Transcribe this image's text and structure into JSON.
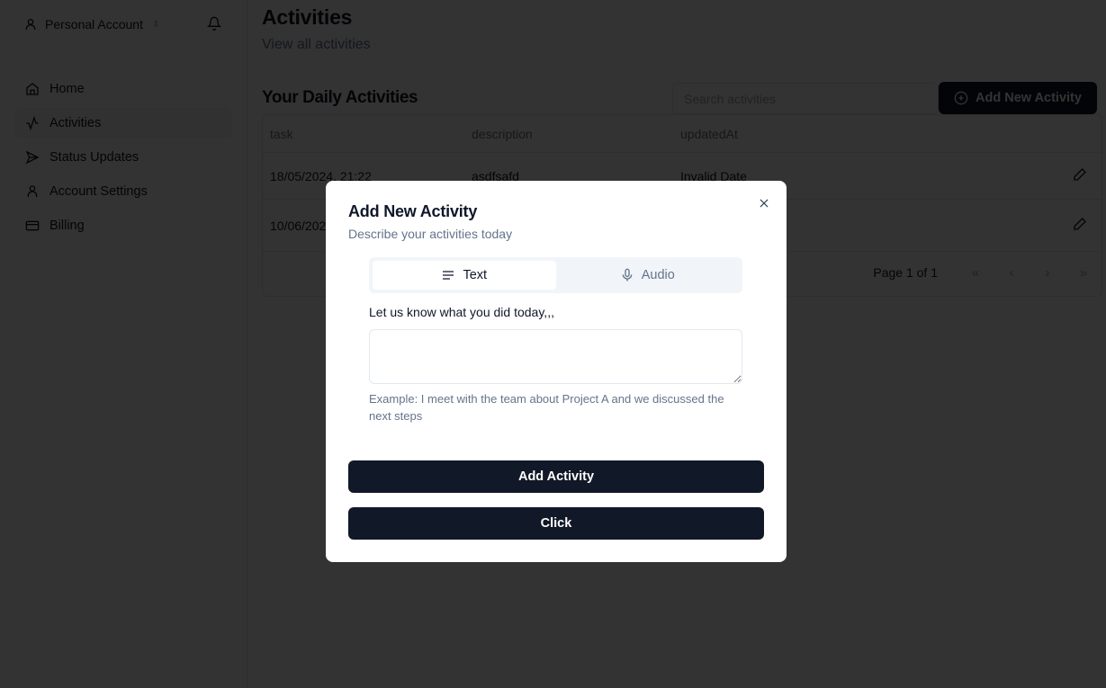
{
  "sidebar": {
    "account_label": "Personal Account",
    "items": [
      {
        "label": "Home",
        "icon": "home-icon"
      },
      {
        "label": "Activities",
        "icon": "activity-icon",
        "active": true
      },
      {
        "label": "Status Updates",
        "icon": "send-icon"
      },
      {
        "label": "Account Settings",
        "icon": "user-icon"
      },
      {
        "label": "Billing",
        "icon": "credit-card-icon"
      }
    ]
  },
  "page": {
    "title": "Activities",
    "subtitle": "View all activities",
    "section_title": "Your Daily Activities",
    "search_placeholder": "Search activities",
    "add_button": "Add New Activity"
  },
  "table": {
    "columns": [
      "task",
      "description",
      "updatedAt"
    ],
    "rows": [
      {
        "task": "18/05/2024, 21:22",
        "description": "asdfsafd",
        "updatedAt": "Invalid Date"
      },
      {
        "task": "10/06/2024",
        "description": "",
        "updatedAt": ""
      }
    ],
    "pagination": "Page 1 of 1"
  },
  "modal": {
    "title": "Add New Activity",
    "subtitle": "Describe your activities today",
    "tabs": [
      {
        "label": "Text",
        "icon": "text-align-icon",
        "active": true
      },
      {
        "label": "Audio",
        "icon": "mic-icon",
        "active": false
      }
    ],
    "field_label": "Let us know what you did today,,,",
    "textarea_value": "",
    "hint": "Example: I meet with the team about Project A and we discussed the next steps",
    "primary_button": "Add Activity",
    "secondary_button": "Click"
  },
  "colors": {
    "primary": "#111827",
    "overlay": "rgba(0,0,0,0.8)",
    "muted_text": "#64748b"
  }
}
